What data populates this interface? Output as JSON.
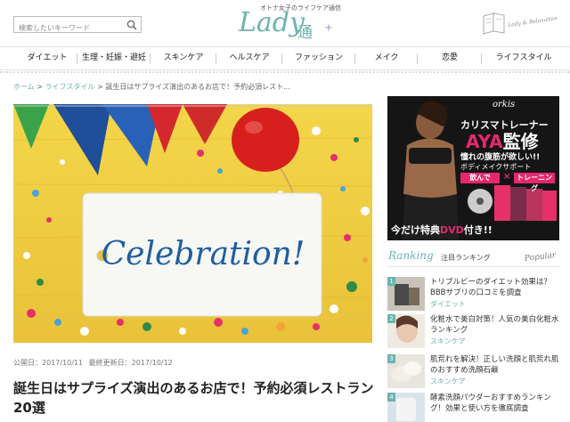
{
  "header": {
    "search_placeholder": "検索したいキーワード",
    "logo_tagline": "オトナ女子のライフケア通信",
    "logo_word": "Lady",
    "logo_kanji": "通",
    "notebook_text": "Lady & Relaxation"
  },
  "nav": {
    "items": [
      {
        "label": "ダイエット"
      },
      {
        "label": "生理・妊娠・避妊"
      },
      {
        "label": "スキンケア"
      },
      {
        "label": "ヘルスケア"
      },
      {
        "label": "ファッション"
      },
      {
        "label": "メイク"
      },
      {
        "label": "恋愛"
      },
      {
        "label": "ライフスタイル"
      }
    ]
  },
  "breadcrumb": {
    "home": "ホーム",
    "sep1": " > ",
    "category": "ライフスタイル",
    "sep2": " > ",
    "current": "誕生日はサプライズ演出のあるお店で！予約必須レスト..."
  },
  "hero": {
    "card_text": "Celebration!"
  },
  "article": {
    "published_label": "公開日：",
    "published": "2017/10/11",
    "updated_label": "最終更新日：",
    "updated": "2017/10/12",
    "title": "誕生日はサプライズ演出のあるお店で！予約必須レストラン20選"
  },
  "ad": {
    "brand": "orkis",
    "line1": "カリスマトレーナー",
    "line2_name": "AYA",
    "line2_rest": "監修",
    "line3": "憧れの腹筋が欲しい!!",
    "line4": "ボディメイクサポート",
    "pill1": "飲んで",
    "times": "×",
    "pill2": "トレーニング",
    "bottom_pre": "今だけ特典",
    "bottom_dvd": "DVD",
    "bottom_post": "付き!!"
  },
  "ranking": {
    "title_en": "Ranking",
    "title_ja": "注目ランキング",
    "popular": "Popular",
    "items": [
      {
        "num": "1",
        "title": "トリプルビーのダイエット効果は？BBBサプリの口コミを調査",
        "category": "ダイエット"
      },
      {
        "num": "2",
        "title": "化粧水で美白対策！人気の美白化粧水ランキング",
        "category": "スキンケア"
      },
      {
        "num": "3",
        "title": "肌荒れを解決！正しい洗顔と肌荒れ肌のおすすめ洗顔石鹸",
        "category": "スキンケア"
      },
      {
        "num": "4",
        "title": "酵素洗顔パウダーおすすめランキング！効果と使い方を徹底調査",
        "category": ""
      }
    ]
  },
  "colors": {
    "accent": "#6cb3ae",
    "pink": "#e5286e"
  }
}
